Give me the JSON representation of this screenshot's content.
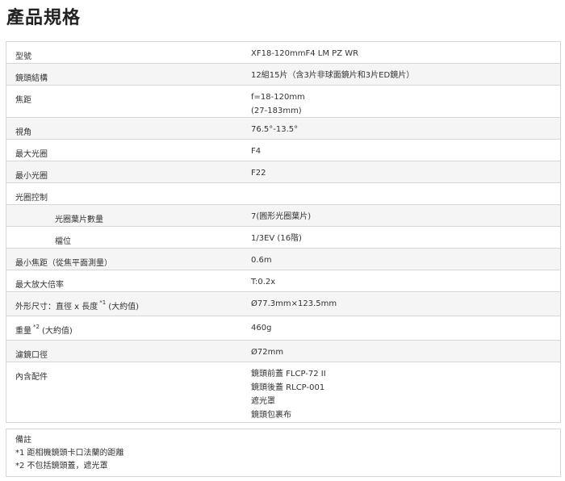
{
  "title": "產品規格",
  "rows": [
    {
      "label": "型號",
      "values": [
        "XF18-120mmF4 LM PZ WR"
      ]
    },
    {
      "label": "鏡頭結構",
      "values": [
        "12組15片（含3片非球面鏡片和3片ED鏡片）"
      ]
    },
    {
      "label": "焦距",
      "values": [
        "f=18-120mm",
        "(27-183mm)"
      ]
    },
    {
      "label": "視角",
      "values": [
        "76.5°-13.5°"
      ]
    },
    {
      "label": "最大光圈",
      "values": [
        "F4"
      ]
    },
    {
      "label": "最小光圈",
      "values": [
        "F22"
      ]
    },
    {
      "label": "光圈控制",
      "values": []
    },
    {
      "label": "光圈葉片數量",
      "values": [
        "7(圓形光圈葉片)"
      ]
    },
    {
      "label": "檔位",
      "values": [
        "1/3EV (16階)"
      ]
    },
    {
      "label": "最小焦距（從焦平面測量）",
      "values": [
        "0.6m"
      ]
    },
    {
      "label": "最大放大倍率",
      "values": [
        "T:0.2x"
      ]
    },
    {
      "label": "外形尺寸：直徑 x 長度",
      "note": "*1",
      "suffix": "(大約值)",
      "values": [
        "Ø77.3mm×123.5mm"
      ]
    },
    {
      "label": "重量",
      "note": "*2",
      "suffix": "(大約值)",
      "values": [
        "460g"
      ]
    },
    {
      "label": "濾鏡口徑",
      "values": [
        "Ø72mm"
      ]
    },
    {
      "label": "內含配件",
      "values": [
        "鏡頭前蓋 FLCP-72 II",
        "鏡頭後蓋 RLCP-001",
        "遮光罩",
        "鏡頭包裹布"
      ]
    }
  ],
  "notes": {
    "heading": "備註",
    "items": [
      "*1 距相機鏡頭卡口法蘭的距離",
      "*2 不包括鏡頭蓋，遮光罩"
    ]
  }
}
